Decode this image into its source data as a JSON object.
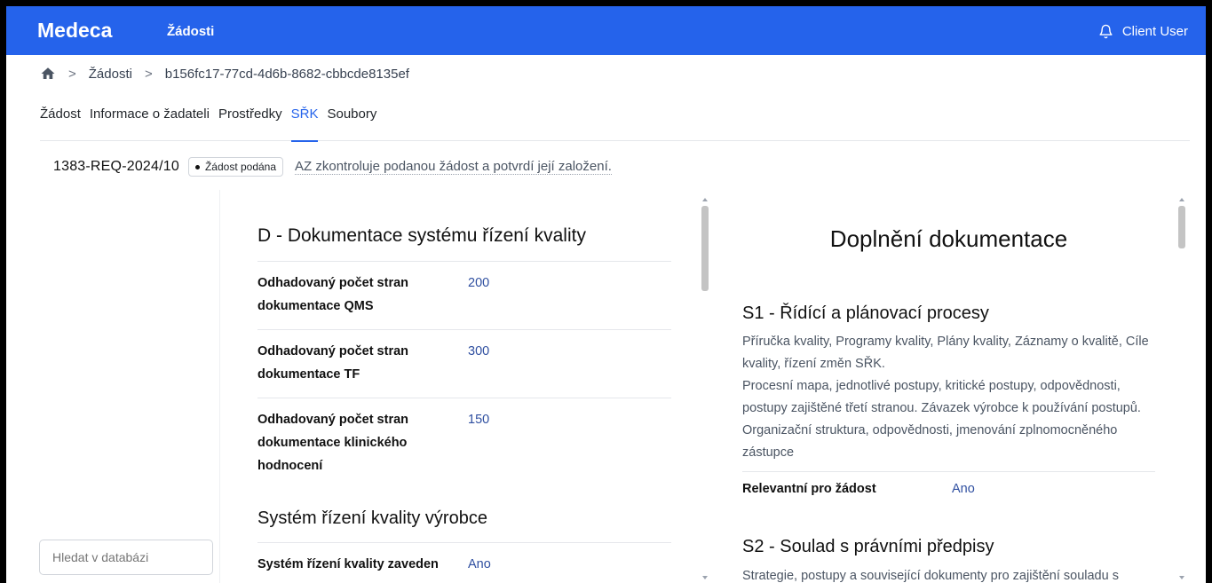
{
  "app": {
    "brand": "Medeca",
    "nav_item": "Žádosti",
    "user": "Client User"
  },
  "breadcrumb": {
    "items": [
      "Žádosti",
      "b156fc17-77cd-4d6b-8682-cbbcde8135ef"
    ],
    "separator": ">"
  },
  "tabs": [
    {
      "label": "Žádost",
      "active": false
    },
    {
      "label": "Informace o žadateli",
      "active": false
    },
    {
      "label": "Prostředky",
      "active": false
    },
    {
      "label": "SŘK",
      "active": true
    },
    {
      "label": "Soubory",
      "active": false
    }
  ],
  "request": {
    "id": "1383-REQ-2024/10",
    "status": "Žádost podána",
    "note": "AZ zkontroluje podanou žádost a potvrdí její založení."
  },
  "search": {
    "placeholder": "Hledat v databázi"
  },
  "left_panel": {
    "section_title": "D - Dokumentace systému řízení kvality",
    "rows": [
      {
        "label": "Odhadovaný počet stran dokumentace QMS",
        "value": "200"
      },
      {
        "label": "Odhadovaný počet stran dokumentace TF",
        "value": "300"
      },
      {
        "label": "Odhadovaný počet stran dokumentace klinického hodnocení",
        "value": "150"
      }
    ],
    "section2_title": "Systém řízení kvality výrobce",
    "rows2": [
      {
        "label": "Systém řízení kvality zaveden",
        "value": "Ano"
      }
    ]
  },
  "right_panel": {
    "title": "Doplnění dokumentace",
    "sections": [
      {
        "title": "S1 - Řídící a plánovací procesy",
        "description_lines": [
          "Příručka kvality, Programy kvality, Plány kvality, Záznamy o kvalitě, Cíle",
          "kvality, řízení změn SŘK.",
          "Procesní mapa, jednotlivé postupy, kritické postupy, odpovědnosti,",
          "postupy zajištěné třetí stranou. Závazek výrobce k používání postupů.",
          "Organizační struktura, odpovědnosti, jmenování zplnomocněného",
          "zástupce"
        ],
        "relevant_label": "Relevantní pro žádost",
        "relevant_value": "Ano"
      },
      {
        "title": "S2 - Soulad s právními předpisy",
        "description_lines": [
          "Strategie, postupy a související dokumenty pro zajištění souladu s"
        ]
      }
    ]
  },
  "colors": {
    "accent": "#2563eb",
    "value_text": "#2f4fa0"
  },
  "icons": {
    "home": "home-icon",
    "bell": "bell-icon"
  }
}
